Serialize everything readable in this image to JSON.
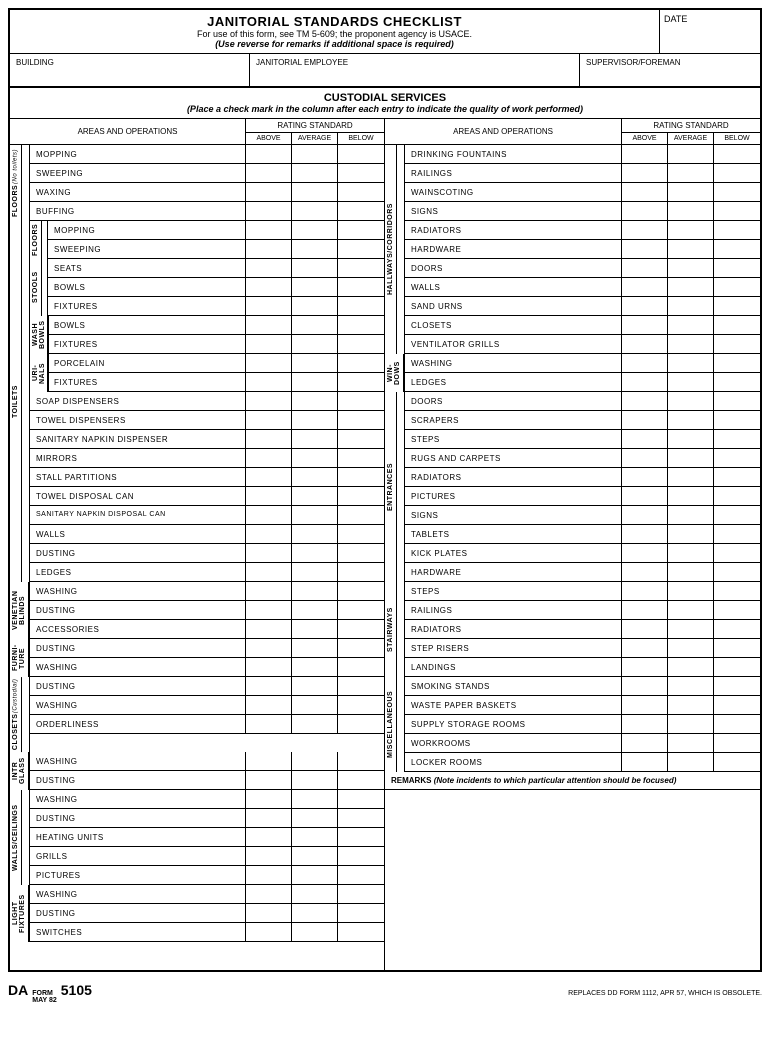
{
  "header": {
    "title": "JANITORIAL STANDARDS CHECKLIST",
    "sub1": "For use of this form, see TM 5-609; the proponent agency is USACE.",
    "sub2": "(Use reverse for remarks if additional space is required)",
    "date_label": "DATE"
  },
  "info": {
    "building": "BUILDING",
    "employee": "JANITORIAL EMPLOYEE",
    "supervisor": "SUPERVISOR/FOREMAN"
  },
  "section": {
    "title": "CUSTODIAL SERVICES",
    "sub": "(Place a check mark in the column after each entry to indicate the quality of work performed)"
  },
  "colhead": {
    "areas": "AREAS AND OPERATIONS",
    "rating": "RATING STANDARD",
    "above": "ABOVE",
    "average": "AVERAGE",
    "below": "BELOW"
  },
  "left": [
    {
      "cat": "FLOORS",
      "catsub": "(No toilets)",
      "items": [
        {
          "t": "MOPPING"
        },
        {
          "t": "SWEEPING"
        },
        {
          "t": "WAXING"
        },
        {
          "t": "BUFFING"
        }
      ]
    },
    {
      "cat": "TOILETS",
      "subs": [
        {
          "sub": "FLOORS",
          "items": [
            {
              "t": "MOPPING"
            },
            {
              "t": "SWEEPING"
            }
          ]
        },
        {
          "sub": "STOOLS",
          "items": [
            {
              "t": "SEATS"
            },
            {
              "t": "BOWLS"
            },
            {
              "t": "FIXTURES"
            }
          ]
        },
        {
          "sub": "WASH BOWLS",
          "items": [
            {
              "t": "BOWLS"
            },
            {
              "t": "FIXTURES"
            }
          ]
        },
        {
          "sub": "URI-NALS",
          "items": [
            {
              "t": "PORCELAIN"
            },
            {
              "t": "FIXTURES"
            }
          ]
        }
      ],
      "items": [
        {
          "t": "SOAP DISPENSERS"
        },
        {
          "t": "TOWEL DISPENSERS"
        },
        {
          "t": "SANITARY NAPKIN DISPENSER"
        },
        {
          "t": "MIRRORS"
        },
        {
          "t": "STALL PARTITIONS"
        },
        {
          "t": "TOWEL DISPOSAL CAN"
        },
        {
          "t": "SANITARY NAPKIN DISPOSAL CAN",
          "two": true
        },
        {
          "t": "WALLS"
        },
        {
          "t": "DUSTING"
        },
        {
          "t": "LEDGES"
        }
      ]
    },
    {
      "cat": "VENETIAN BLINDS",
      "items": [
        {
          "t": "WASHING"
        },
        {
          "t": "DUSTING"
        },
        {
          "t": "ACCESSORIES"
        }
      ]
    },
    {
      "cat": "FURNI-TURE",
      "items": [
        {
          "t": "DUSTING"
        },
        {
          "t": "WASHING"
        }
      ]
    },
    {
      "cat": "CLOSETS",
      "catsub": "(Custodial)",
      "items": [
        {
          "t": "DUSTING"
        },
        {
          "t": "WASHING"
        },
        {
          "t": "ORDERLINESS"
        }
      ]
    },
    {
      "cat": "INTR GLASS",
      "items": [
        {
          "t": "WASHING"
        },
        {
          "t": "DUSTING"
        }
      ]
    },
    {
      "cat": "WALLS/CEILINGS",
      "items": [
        {
          "t": "WASHING"
        },
        {
          "t": "DUSTING"
        },
        {
          "t": "HEATING UNITS"
        },
        {
          "t": "GRILLS"
        },
        {
          "t": "PICTURES"
        }
      ]
    },
    {
      "cat": "LIGHT FIXTURES",
      "items": [
        {
          "t": "WASHING"
        },
        {
          "t": "DUSTING"
        },
        {
          "t": "SWITCHES"
        }
      ]
    }
  ],
  "right": [
    {
      "cat": "HALLWAYS/CORRIDORS",
      "items": [
        {
          "t": "DRINKING FOUNTAINS"
        },
        {
          "t": "RAILINGS"
        },
        {
          "t": "WAINSCOTING"
        },
        {
          "t": "SIGNS"
        },
        {
          "t": "RADIATORS"
        },
        {
          "t": "HARDWARE"
        },
        {
          "t": "DOORS"
        },
        {
          "t": "WALLS"
        },
        {
          "t": "SAND URNS"
        },
        {
          "t": "CLOSETS"
        },
        {
          "t": "VENTILATOR GRILLS"
        }
      ]
    },
    {
      "cat": "WIN-DOWS",
      "items": [
        {
          "t": "WASHING"
        },
        {
          "t": "LEDGES"
        }
      ]
    },
    {
      "cat": "ENTRANCES",
      "items": [
        {
          "t": "DOORS"
        },
        {
          "t": "SCRAPERS"
        },
        {
          "t": "STEPS"
        },
        {
          "t": "RUGS AND CARPETS"
        },
        {
          "t": "RADIATORS"
        },
        {
          "t": "PICTURES"
        },
        {
          "t": "SIGNS"
        },
        {
          "t": "TABLETS"
        },
        {
          "t": "KICK PLATES"
        },
        {
          "t": "HARDWARE"
        }
      ]
    },
    {
      "cat": "STAIRWAYS",
      "items": [
        {
          "t": "STEPS"
        },
        {
          "t": "RAILINGS"
        },
        {
          "t": "RADIATORS"
        },
        {
          "t": "STEP RISERS"
        },
        {
          "t": "LANDINGS"
        }
      ]
    },
    {
      "cat": "MISCELLANEOUS",
      "items": [
        {
          "t": "SMOKING STANDS"
        },
        {
          "t": "WASTE PAPER BASKETS"
        },
        {
          "t": "SUPPLY STORAGE ROOMS"
        },
        {
          "t": "WORKROOMS"
        },
        {
          "t": "LOCKER ROOMS"
        }
      ]
    }
  ],
  "remarks": {
    "title": "REMARKS",
    "sub": "(Note incidents to which particular attention should be focused)"
  },
  "footer": {
    "da": "DA",
    "form": "FORM",
    "date": "MAY 82",
    "num": "5105",
    "right": "REPLACES DD FORM 1112, APR 57, WHICH IS OBSOLETE."
  }
}
